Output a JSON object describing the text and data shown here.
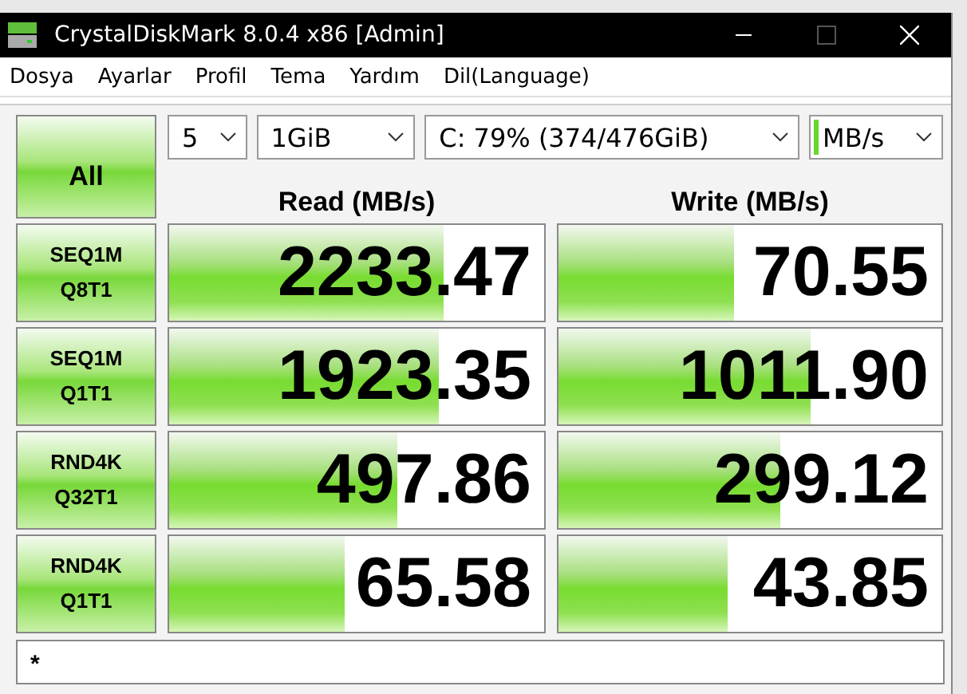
{
  "window": {
    "title": "CrystalDiskMark 8.0.4 x86 [Admin]"
  },
  "menu": [
    "Dosya",
    "Ayarlar",
    "Profil",
    "Tema",
    "Yardım",
    "Dil(Language)"
  ],
  "all_button": "All",
  "dropdowns": [
    {
      "value": "5",
      "kind": "plain"
    },
    {
      "value": "1GiB",
      "kind": "plain"
    },
    {
      "value": "C: 79% (374/476GiB)",
      "kind": "plain"
    },
    {
      "value": "MB/s",
      "kind": "unit"
    }
  ],
  "columns": [
    "Read (MB/s)",
    "Write (MB/s)"
  ],
  "tests": [
    {
      "label": "SEQ1M",
      "sub": "Q8T1",
      "read": {
        "value": "2233.47",
        "level": 0.73
      },
      "write": {
        "value": "70.55",
        "level": 0.46
      }
    },
    {
      "label": "SEQ1M",
      "sub": "Q1T1",
      "read": {
        "value": "1923.35",
        "level": 0.72
      },
      "write": {
        "value": "1011.90",
        "level": 0.66
      }
    },
    {
      "label": "RND4K",
      "sub": "Q32T1",
      "read": {
        "value": "497.86",
        "level": 0.61
      },
      "write": {
        "value": "299.12",
        "level": 0.58
      }
    },
    {
      "label": "RND4K",
      "sub": "Q1T1",
      "read": {
        "value": "65.58",
        "level": 0.47
      },
      "write": {
        "value": "43.85",
        "level": 0.44
      }
    }
  ],
  "comment": "*"
}
